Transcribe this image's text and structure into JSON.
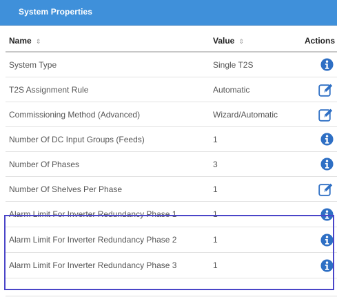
{
  "panel": {
    "title": "System Properties"
  },
  "columns": {
    "name": "Name",
    "value": "Value",
    "actions": "Actions",
    "sort_glyph": "⇕"
  },
  "rows": [
    {
      "name": "System Type",
      "value": "Single T2S",
      "action_icon": "info-icon"
    },
    {
      "name": "T2S Assignment Rule",
      "value": "Automatic",
      "action_icon": "edit-icon"
    },
    {
      "name": "Commissioning Method (Advanced)",
      "value": "Wizard/Automatic",
      "action_icon": "edit-icon"
    },
    {
      "name": "Number Of DC Input Groups (Feeds)",
      "value": "1",
      "action_icon": "info-icon"
    },
    {
      "name": "Number Of Phases",
      "value": "3",
      "action_icon": "info-icon"
    },
    {
      "name": "Number Of Shelves Per Phase",
      "value": "1",
      "action_icon": "edit-icon"
    },
    {
      "name": "Alarm Limit For Inverter Redundancy Phase 1",
      "value": "1",
      "action_icon": "info-icon"
    },
    {
      "name": "Alarm Limit For Inverter Redundancy Phase 2",
      "value": "1",
      "action_icon": "info-icon"
    },
    {
      "name": "Alarm Limit For Inverter Redundancy Phase 3",
      "value": "1",
      "action_icon": "info-icon"
    }
  ],
  "colors": {
    "header_bg": "#3f90da",
    "icon_blue": "#2e6fc4",
    "highlight_border": "#4a45c8"
  }
}
